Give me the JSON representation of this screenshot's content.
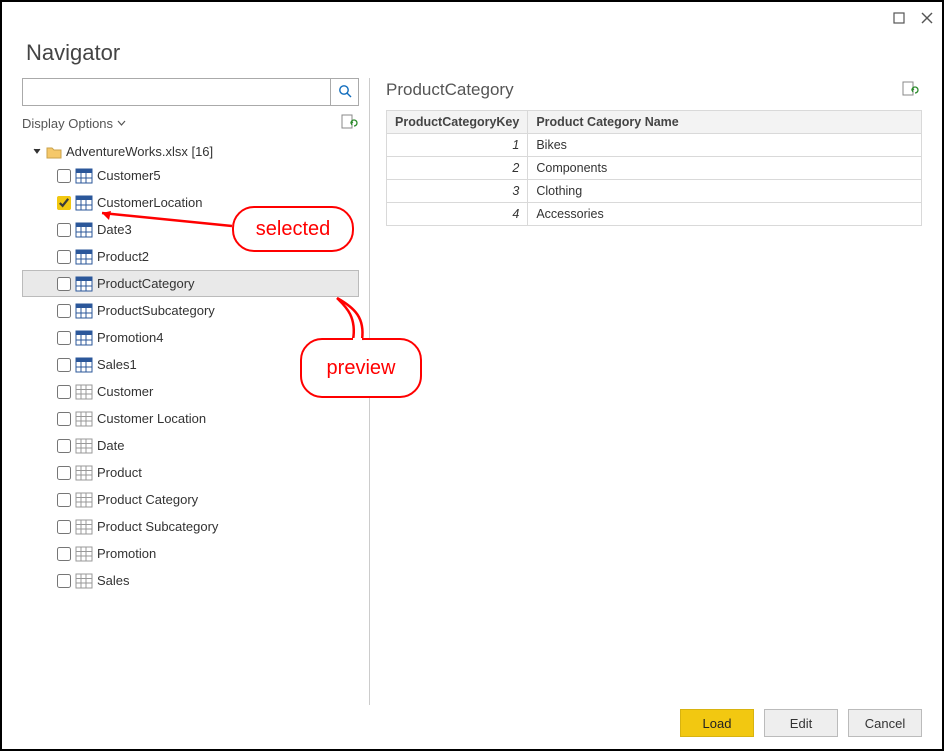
{
  "window": {
    "title": "Navigator"
  },
  "search": {
    "placeholder": ""
  },
  "options": {
    "display_label": "Display Options"
  },
  "tree": {
    "root_label": "AdventureWorks.xlsx [16]",
    "items": [
      {
        "label": "Customer5",
        "checked": false,
        "highlight": false,
        "kind": "table"
      },
      {
        "label": "CustomerLocation",
        "checked": true,
        "highlight": false,
        "kind": "table"
      },
      {
        "label": "Date3",
        "checked": false,
        "highlight": false,
        "kind": "table"
      },
      {
        "label": "Product2",
        "checked": false,
        "highlight": false,
        "kind": "table"
      },
      {
        "label": "ProductCategory",
        "checked": false,
        "highlight": true,
        "kind": "table"
      },
      {
        "label": "ProductSubcategory",
        "checked": false,
        "highlight": false,
        "kind": "table"
      },
      {
        "label": "Promotion4",
        "checked": false,
        "highlight": false,
        "kind": "table"
      },
      {
        "label": "Sales1",
        "checked": false,
        "highlight": false,
        "kind": "table"
      },
      {
        "label": "Customer",
        "checked": false,
        "highlight": false,
        "kind": "sheet"
      },
      {
        "label": "Customer Location",
        "checked": false,
        "highlight": false,
        "kind": "sheet"
      },
      {
        "label": "Date",
        "checked": false,
        "highlight": false,
        "kind": "sheet"
      },
      {
        "label": "Product",
        "checked": false,
        "highlight": false,
        "kind": "sheet"
      },
      {
        "label": "Product Category",
        "checked": false,
        "highlight": false,
        "kind": "sheet"
      },
      {
        "label": "Product Subcategory",
        "checked": false,
        "highlight": false,
        "kind": "sheet"
      },
      {
        "label": "Promotion",
        "checked": false,
        "highlight": false,
        "kind": "sheet"
      },
      {
        "label": "Sales",
        "checked": false,
        "highlight": false,
        "kind": "sheet"
      }
    ]
  },
  "preview": {
    "title": "ProductCategory",
    "columns": [
      "ProductCategoryKey",
      "Product Category Name"
    ],
    "rows": [
      {
        "ProductCategoryKey": 1,
        "Product Category Name": "Bikes"
      },
      {
        "ProductCategoryKey": 2,
        "Product Category Name": "Components"
      },
      {
        "ProductCategoryKey": 3,
        "Product Category Name": "Clothing"
      },
      {
        "ProductCategoryKey": 4,
        "Product Category Name": "Accessories"
      }
    ]
  },
  "buttons": {
    "load": "Load",
    "edit": "Edit",
    "cancel": "Cancel"
  },
  "annotations": {
    "selected": "selected",
    "preview": "preview"
  }
}
